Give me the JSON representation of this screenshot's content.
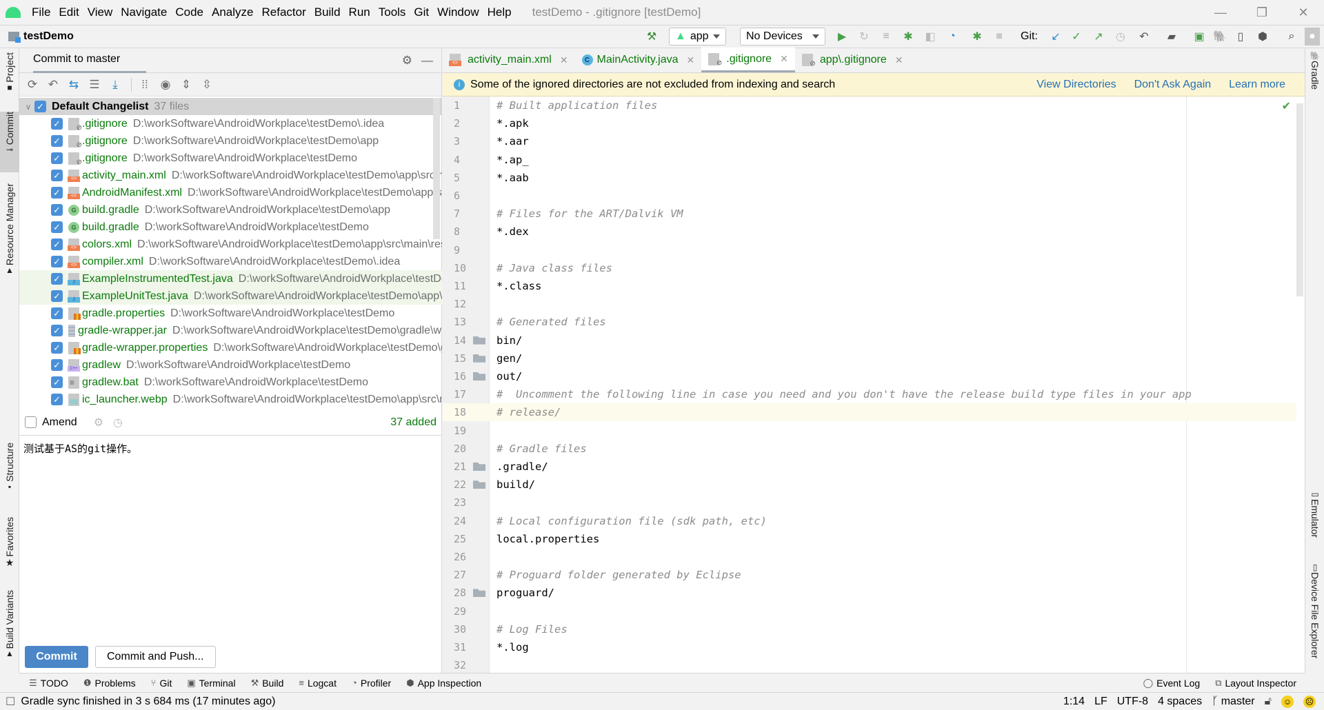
{
  "window": {
    "title": "testDemo - .gitignore [testDemo]",
    "menu": [
      "File",
      "Edit",
      "View",
      "Navigate",
      "Code",
      "Analyze",
      "Refactor",
      "Build",
      "Run",
      "Tools",
      "Git",
      "Window",
      "Help"
    ]
  },
  "navbar": {
    "project": "testDemo",
    "run_config": "app",
    "device": "No Devices",
    "git_label": "Git:"
  },
  "left_strip": [
    "Project",
    "Commit",
    "Resource Manager",
    "Structure",
    "Favorites",
    "Build Variants"
  ],
  "right_strip": [
    "Gradle",
    "Emulator",
    "Device File Explorer"
  ],
  "commit_panel": {
    "tab": "Commit to master",
    "changelist": {
      "name": "Default Changelist",
      "count": "37 files",
      "checked": true
    },
    "files": [
      {
        "name": ".gitignore",
        "path": "D:\\workSoftware\\AndroidWorkplace\\testDemo\\.idea",
        "type": "git",
        "checked": true
      },
      {
        "name": ".gitignore",
        "path": "D:\\workSoftware\\AndroidWorkplace\\testDemo\\app",
        "type": "git",
        "checked": true
      },
      {
        "name": ".gitignore",
        "path": "D:\\workSoftware\\AndroidWorkplace\\testDemo",
        "type": "git",
        "checked": true
      },
      {
        "name": "activity_main.xml",
        "path": "D:\\workSoftware\\AndroidWorkplace\\testDemo\\app\\src\\main\\res\\layout",
        "type": "xml",
        "checked": true
      },
      {
        "name": "AndroidManifest.xml",
        "path": "D:\\workSoftware\\AndroidWorkplace\\testDemo\\app\\src\\main",
        "type": "xml",
        "checked": true
      },
      {
        "name": "build.gradle",
        "path": "D:\\workSoftware\\AndroidWorkplace\\testDemo\\app",
        "type": "gradle",
        "checked": true
      },
      {
        "name": "build.gradle",
        "path": "D:\\workSoftware\\AndroidWorkplace\\testDemo",
        "type": "gradle",
        "checked": true
      },
      {
        "name": "colors.xml",
        "path": "D:\\workSoftware\\AndroidWorkplace\\testDemo\\app\\src\\main\\res\\values",
        "type": "xml",
        "checked": true
      },
      {
        "name": "compiler.xml",
        "path": "D:\\workSoftware\\AndroidWorkplace\\testDemo\\.idea",
        "type": "xml",
        "checked": true
      },
      {
        "name": "ExampleInstrumentedTest.java",
        "path": "D:\\workSoftware\\AndroidWorkplace\\testDemo\\app\\src\\androidTest",
        "type": "java",
        "checked": true,
        "highlight": true
      },
      {
        "name": "ExampleUnitTest.java",
        "path": "D:\\workSoftware\\AndroidWorkplace\\testDemo\\app\\src\\test",
        "type": "java",
        "checked": true,
        "highlight": true
      },
      {
        "name": "gradle.properties",
        "path": "D:\\workSoftware\\AndroidWorkplace\\testDemo",
        "type": "prop",
        "checked": true
      },
      {
        "name": "gradle-wrapper.jar",
        "path": "D:\\workSoftware\\AndroidWorkplace\\testDemo\\gradle\\wrapper",
        "type": "jar",
        "checked": true
      },
      {
        "name": "gradle-wrapper.properties",
        "path": "D:\\workSoftware\\AndroidWorkplace\\testDemo\\gradle\\wrapper",
        "type": "prop",
        "checked": true
      },
      {
        "name": "gradlew",
        "path": "D:\\workSoftware\\AndroidWorkplace\\testDemo",
        "type": "cpp",
        "checked": true
      },
      {
        "name": "gradlew.bat",
        "path": "D:\\workSoftware\\AndroidWorkplace\\testDemo",
        "type": "bat",
        "checked": true
      },
      {
        "name": "ic_launcher.webp",
        "path": "D:\\workSoftware\\AndroidWorkplace\\testDemo\\app\\src\\main\\res",
        "type": "img",
        "checked": true
      }
    ],
    "amend_label": "Amend",
    "amend_checked": false,
    "summary": "37 added",
    "message": "测试基于AS的git操作。",
    "commit_button": "Commit",
    "commit_push_button": "Commit and Push..."
  },
  "editor": {
    "tabs": [
      {
        "label": "activity_main.xml",
        "type": "xml",
        "active": false
      },
      {
        "label": "MainActivity.java",
        "type": "class",
        "active": false
      },
      {
        "label": ".gitignore",
        "type": "git",
        "active": true
      },
      {
        "label": "app\\.gitignore",
        "type": "git",
        "active": false
      }
    ],
    "notification": {
      "text": "Some of the ignored directories are not excluded from indexing and search",
      "links": [
        "View Directories",
        "Don't Ask Again",
        "Learn more"
      ]
    },
    "current_line": 18,
    "lines": [
      {
        "n": 1,
        "text": "# Built application files",
        "comment": true
      },
      {
        "n": 2,
        "text": "*.apk"
      },
      {
        "n": 3,
        "text": "*.aar"
      },
      {
        "n": 4,
        "text": "*.ap_"
      },
      {
        "n": 5,
        "text": "*.aab"
      },
      {
        "n": 6,
        "text": ""
      },
      {
        "n": 7,
        "text": "# Files for the ART/Dalvik VM",
        "comment": true
      },
      {
        "n": 8,
        "text": "*.dex"
      },
      {
        "n": 9,
        "text": ""
      },
      {
        "n": 10,
        "text": "# Java class files",
        "comment": true
      },
      {
        "n": 11,
        "text": "*.class"
      },
      {
        "n": 12,
        "text": ""
      },
      {
        "n": 13,
        "text": "# Generated files",
        "comment": true
      },
      {
        "n": 14,
        "text": "bin/",
        "dir": true
      },
      {
        "n": 15,
        "text": "gen/",
        "dir": true
      },
      {
        "n": 16,
        "text": "out/",
        "dir": true
      },
      {
        "n": 17,
        "text": "#  Uncomment the following line in case you need and you don't have the release build type files in your app",
        "comment": true
      },
      {
        "n": 18,
        "text": "# release/",
        "comment": true
      },
      {
        "n": 19,
        "text": ""
      },
      {
        "n": 20,
        "text": "# Gradle files",
        "comment": true
      },
      {
        "n": 21,
        "text": ".gradle/",
        "dir": true
      },
      {
        "n": 22,
        "text": "build/",
        "dir": true
      },
      {
        "n": 23,
        "text": ""
      },
      {
        "n": 24,
        "text": "# Local configuration file (sdk path, etc)",
        "comment": true
      },
      {
        "n": 25,
        "text": "local.properties"
      },
      {
        "n": 26,
        "text": ""
      },
      {
        "n": 27,
        "text": "# Proguard folder generated by Eclipse",
        "comment": true
      },
      {
        "n": 28,
        "text": "proguard/",
        "dir": true
      },
      {
        "n": 29,
        "text": ""
      },
      {
        "n": 30,
        "text": "# Log Files",
        "comment": true
      },
      {
        "n": 31,
        "text": "*.log"
      },
      {
        "n": 32,
        "text": ""
      }
    ]
  },
  "bottom_tools": {
    "left": [
      {
        "label": "TODO",
        "icon": "list-icon"
      },
      {
        "label": "Problems",
        "icon": "warning-icon"
      },
      {
        "label": "Git",
        "icon": "git-branch-icon"
      },
      {
        "label": "Terminal",
        "icon": "terminal-icon"
      },
      {
        "label": "Build",
        "icon": "hammer-icon"
      },
      {
        "label": "Logcat",
        "icon": "logcat-icon"
      },
      {
        "label": "Profiler",
        "icon": "gauge-icon"
      },
      {
        "label": "App Inspection",
        "icon": "inspection-icon"
      }
    ],
    "right": [
      {
        "label": "Event Log",
        "icon": "event-log-icon"
      },
      {
        "label": "Layout Inspector",
        "icon": "layout-inspector-icon"
      }
    ]
  },
  "status": {
    "message": "Gradle sync finished in 3 s 684 ms (17 minutes ago)",
    "position": "1:14",
    "line_sep": "LF",
    "encoding": "UTF-8",
    "indent": "4 spaces",
    "branch": "master"
  }
}
